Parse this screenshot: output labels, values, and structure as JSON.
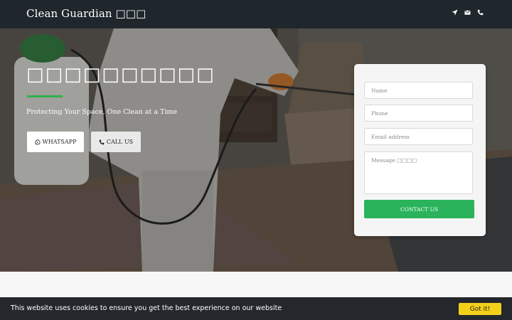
{
  "navbar": {
    "brand": "Clean Guardian □□□",
    "icons": [
      "location-arrow-icon",
      "envelope-icon",
      "phone-icon"
    ]
  },
  "hero": {
    "title": "□□□□□□□□□□",
    "tagline": "Protecting Your Space, One Clean at a Time",
    "whatsapp_label": "WHATSAPP",
    "call_label": "CALL US",
    "accent_color": "#2eb24d"
  },
  "contact_form": {
    "name_placeholder": "Name",
    "phone_placeholder": "Phone",
    "email_placeholder": "Email address",
    "message_placeholder": "Message □□□□",
    "submit_label": "CONTACT US",
    "submit_color": "#2ab35b"
  },
  "cookie_bar": {
    "text": "This website uses cookies to ensure you get the best experience on our website",
    "button_label": "Got it!",
    "button_color": "#f5d019"
  }
}
